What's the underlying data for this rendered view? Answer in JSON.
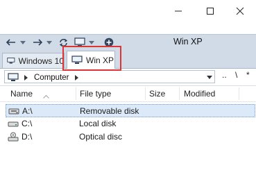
{
  "window": {
    "title": "Win XP",
    "minimize_icon": "minimize-icon",
    "maximize_icon": "maximize-icon",
    "close_icon": "close-icon"
  },
  "toolbar": {
    "back_icon": "back-arrow-icon",
    "forward_icon": "forward-arrow-icon",
    "refresh_icon": "refresh-icon",
    "computer_icon": "computer-icon",
    "add_icon": "add-tab-icon"
  },
  "tabs": [
    {
      "label": "Windows 10",
      "active": false
    },
    {
      "label": "Win XP",
      "active": true
    }
  ],
  "path": {
    "crumb": "Computer",
    "dotdot": "..",
    "backslash": "\\",
    "asterisk": "*"
  },
  "columns": [
    "Name",
    "File type",
    "Size",
    "Modified"
  ],
  "rows": [
    {
      "name": "A:\\",
      "type": "Removable disk",
      "icon": "floppy-drive-icon",
      "selected": true
    },
    {
      "name": "C:\\",
      "type": "Local disk",
      "icon": "hard-drive-icon",
      "selected": false
    },
    {
      "name": "D:\\",
      "type": "Optical disc",
      "icon": "optical-drive-icon",
      "selected": false
    }
  ],
  "colors": {
    "toolbar_bg": "#d1dbe8",
    "highlight_border": "#e03434",
    "selected_row": "#dbe9f8"
  }
}
